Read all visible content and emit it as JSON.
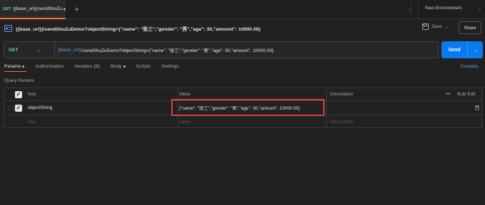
{
  "tabbar": {
    "tab_method": "GET",
    "tab_name": "{{base_url}}/sendShuZu",
    "plus": "+",
    "env": "New Environment",
    "chevron": "⌄"
  },
  "header": {
    "title": "{{base_url}}/sendShuZuDemo?objectString={\"name\": \"张三\",\"gender\": \"男\",\"age\": 30,\"amount\": 10000.00}",
    "save_label": "Save",
    "share_label": "Share"
  },
  "request": {
    "method": "GET",
    "url_var": "{{base_url}}",
    "url_rest": " /sendShuZuDemo?objectString={\"name\": \"张三\",\"gender\": \"男\",\"age\": 30,\"amount\": 10000.00}",
    "send_label": "Send"
  },
  "tabs": {
    "params": "Params",
    "authorization": "Authorization",
    "headers": "Headers",
    "headers_count": "(8)",
    "body": "Body",
    "scripts": "Scripts",
    "settings": "Settings",
    "cookies": "Cookies"
  },
  "query_params": {
    "label": "Query Params",
    "columns": {
      "key": "Key",
      "value": "Value",
      "description": "Description",
      "bulk_edit": "Bulk Edit",
      "more": "•••"
    },
    "rows": [
      {
        "key": "objectString",
        "value": "{\"name\": \"张三\",\"gender\": \"男\",\"age\": 30,\"amount\": 10000.00}",
        "description": ""
      }
    ],
    "placeholders": {
      "key": "Key",
      "value": "Value",
      "description": "Description"
    }
  },
  "colors": {
    "accent": "#ff6c37",
    "send": "#097bed",
    "get": "#6bdd9a",
    "highlight": "#e03c49",
    "var": "#6c9ce8"
  }
}
